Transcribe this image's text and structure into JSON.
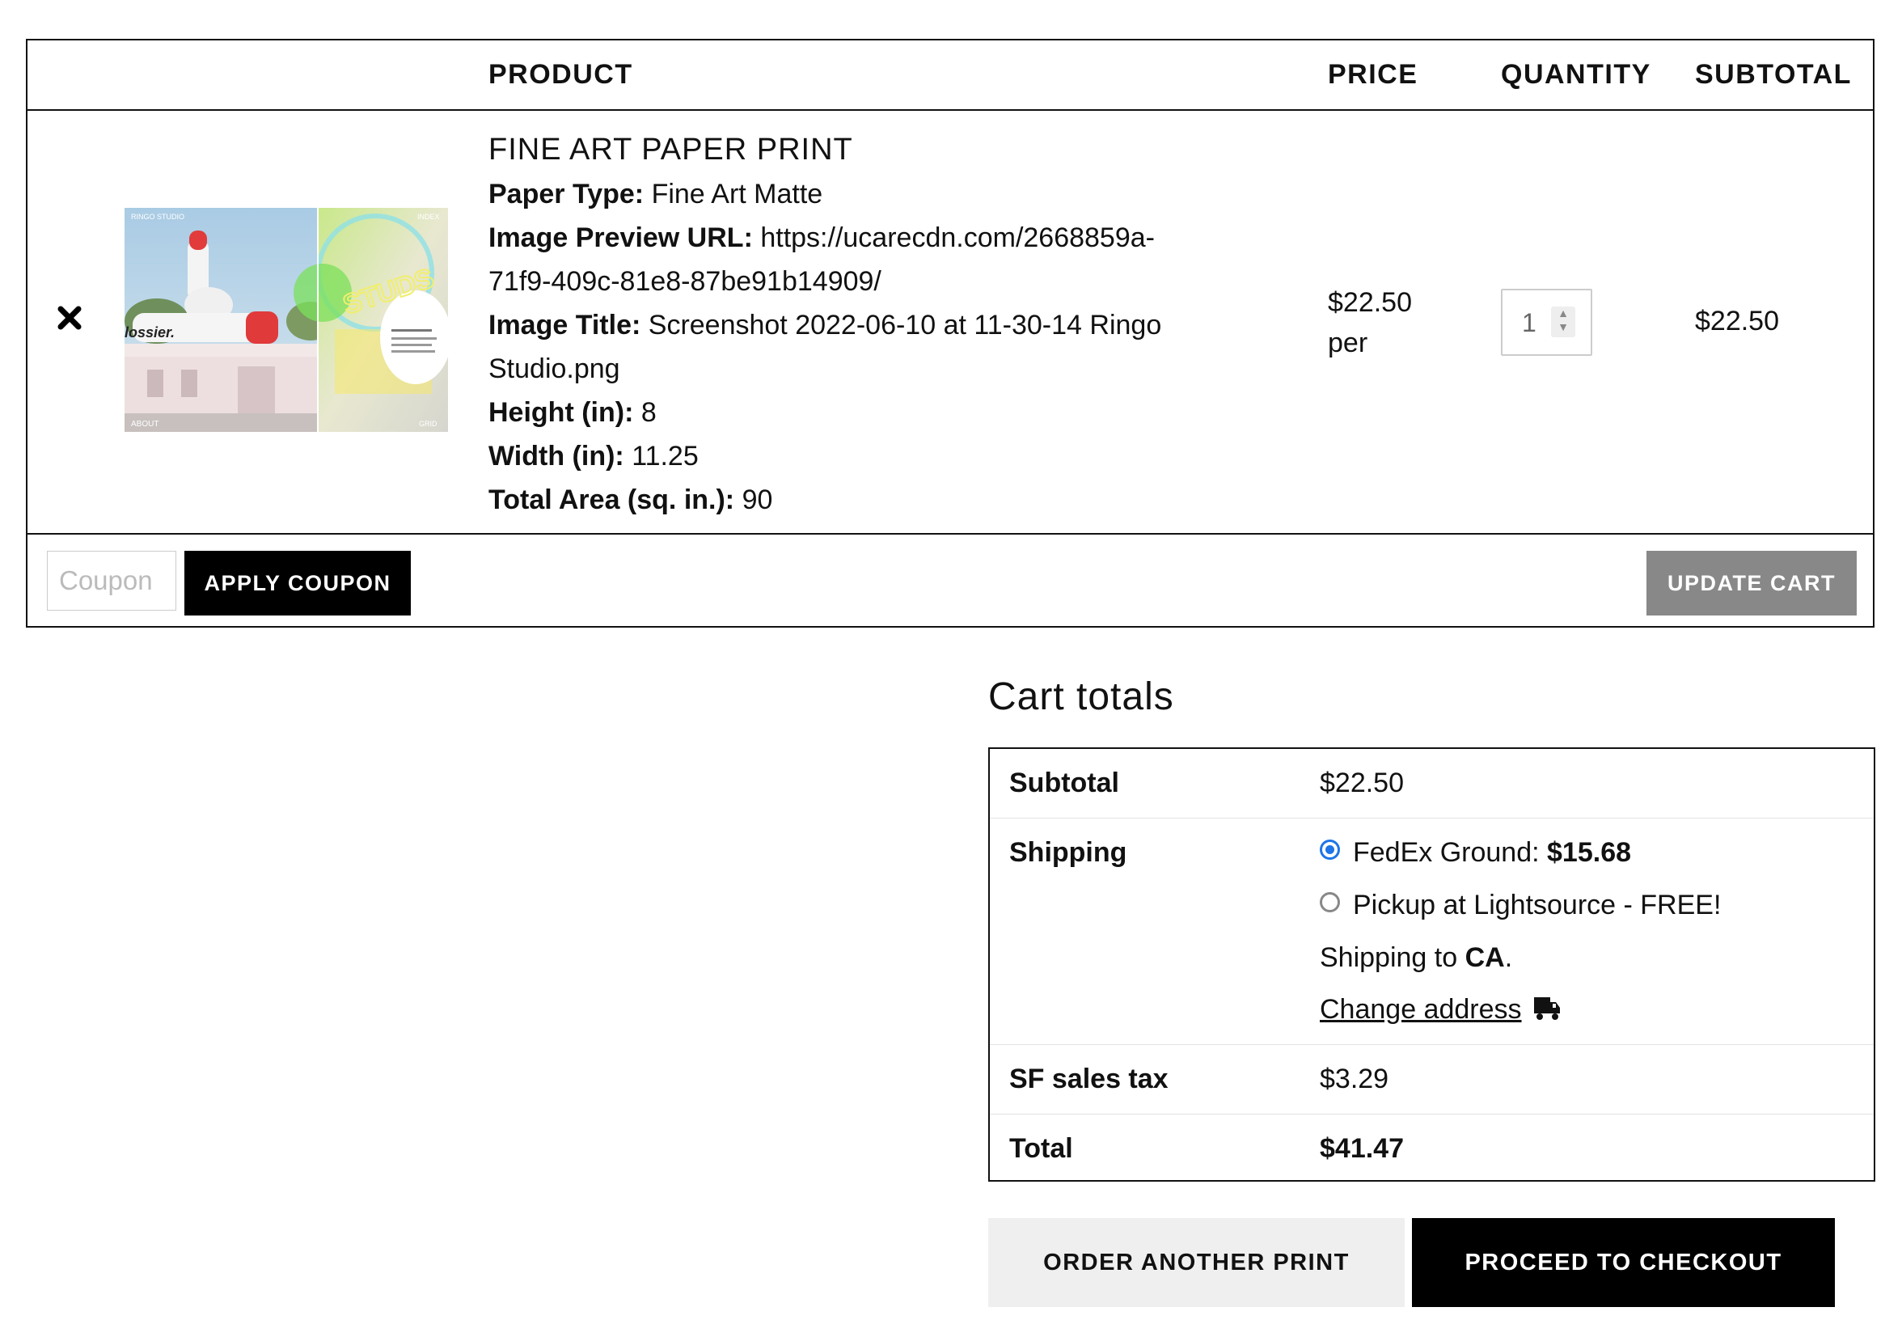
{
  "cart": {
    "headers": {
      "product": "PRODUCT",
      "price": "PRICE",
      "quantity": "QUANTITY",
      "subtotal": "SUBTOTAL"
    },
    "item": {
      "remove_icon": "close-icon",
      "name": "FINE ART PAPER PRINT",
      "meta": [
        {
          "label": "Paper Type:",
          "value": "Fine Art Matte"
        },
        {
          "label": "Image Preview URL:",
          "value": "https://ucarecdn.com/2668859a-"
        },
        {
          "label": "",
          "value": "71f9-409c-81e8-87be91b14909/"
        },
        {
          "label": "Image Title:",
          "value": "Screenshot 2022-06-10 at 11-30-14 Ringo"
        },
        {
          "label": "",
          "value": "Studio.png"
        },
        {
          "label": "Height (in):",
          "value": "8"
        },
        {
          "label": "Width (in):",
          "value": "11.25"
        },
        {
          "label": "Total Area (sq. in.):",
          "value": "90"
        }
      ],
      "price": "$22.50",
      "price_suffix": "per",
      "quantity": "1",
      "subtotal": "$22.50",
      "thumbnail": {
        "left_top_text": "RINGO STUDIO",
        "left_sign": "lossier.",
        "left_bottom_text": "ABOUT",
        "right_top_text": "INDEX",
        "right_neon": "STUDS",
        "right_bottom_text": "GRID"
      }
    },
    "coupon": {
      "placeholder": "Coupon"
    },
    "apply_coupon_label": "APPLY COUPON",
    "update_cart_label": "UPDATE CART"
  },
  "totals": {
    "title": "Cart totals",
    "subtotal_label": "Subtotal",
    "subtotal_value": "$22.50",
    "shipping_label": "Shipping",
    "shipping_options": [
      {
        "text": "FedEx Ground: ",
        "amount": "$15.68",
        "selected": true
      },
      {
        "text": "Pickup at Lightsource - FREE!",
        "amount": "",
        "selected": false
      }
    ],
    "shipping_to_prefix": "Shipping to ",
    "shipping_to_region": "CA",
    "shipping_to_suffix": ".",
    "change_address_label": "Change address",
    "change_address_icon": "truck-icon",
    "tax_label": "SF sales tax",
    "tax_value": "$3.29",
    "total_label": "Total",
    "total_value": "$41.47"
  },
  "buttons": {
    "order_another": "ORDER ANOTHER PRINT",
    "checkout": "PROCEED TO CHECKOUT"
  },
  "colors": {
    "primary_button": "#000000",
    "secondary_button": "#efefef",
    "disabled_button": "#888888",
    "radio_selected": "#1e74e8",
    "border": "#111111"
  }
}
